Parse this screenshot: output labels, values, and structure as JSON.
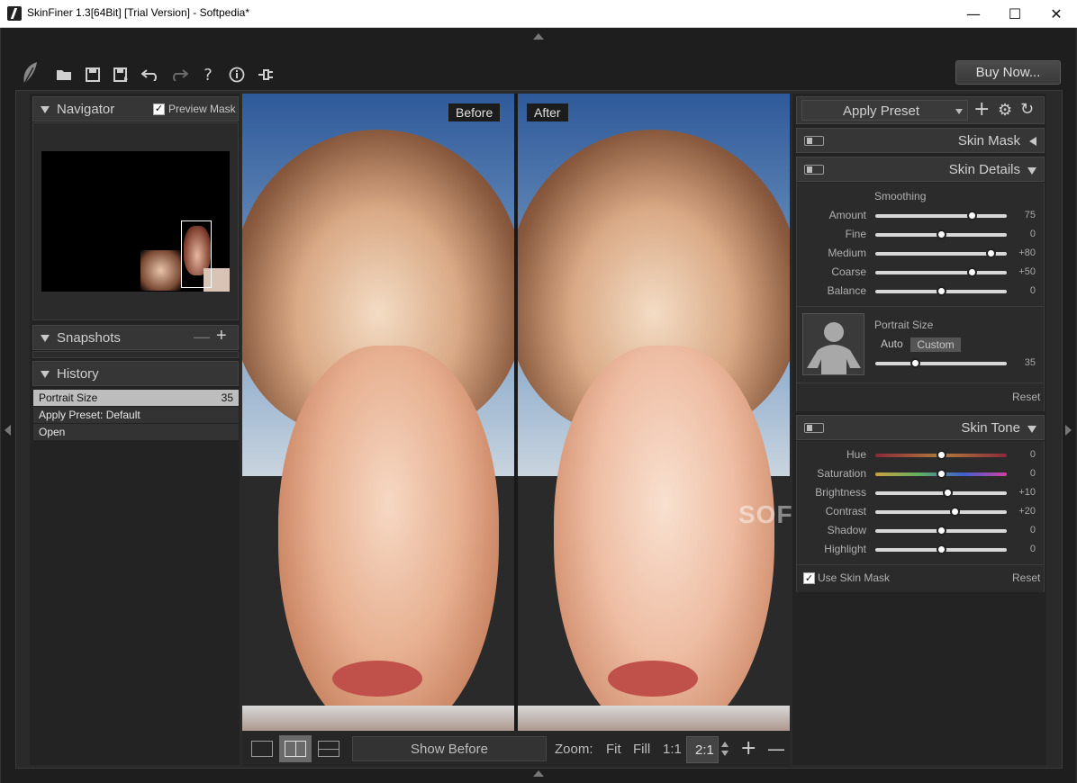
{
  "window": {
    "title": "SkinFiner 1.3[64Bit] [Trial Version] - Softpedia*"
  },
  "toolbar": {
    "buy_label": "Buy Now..."
  },
  "navigator": {
    "title": "Navigator",
    "preview_mask_label": "Preview Mask",
    "preview_mask_checked": true
  },
  "snapshots": {
    "title": "Snapshots"
  },
  "history": {
    "title": "History",
    "items": [
      {
        "label": "Portrait Size",
        "value": "35",
        "selected": true
      },
      {
        "label": "Apply Preset: Default",
        "value": ""
      },
      {
        "label": "Open",
        "value": ""
      }
    ]
  },
  "images": {
    "before_label": "Before",
    "after_label": "After"
  },
  "bottom": {
    "show_before_label": "Show Before",
    "zoom_label": "Zoom:",
    "fit_label": "Fit",
    "fill_label": "Fill",
    "one_to_one_label": "1:1",
    "zoom_value": "2:1"
  },
  "right": {
    "apply_preset_label": "Apply Preset",
    "skin_mask_title": "Skin Mask",
    "skin_details_title": "Skin Details",
    "smoothing_label": "Smoothing",
    "sliders": [
      {
        "label": "Amount",
        "value": "75",
        "pos": 0.73
      },
      {
        "label": "Fine",
        "value": "0",
        "pos": 0.5
      },
      {
        "label": "Medium",
        "value": "+80",
        "pos": 0.88
      },
      {
        "label": "Coarse",
        "value": "+50",
        "pos": 0.73
      },
      {
        "label": "Balance",
        "value": "0",
        "pos": 0.5
      }
    ],
    "portrait": {
      "title": "Portrait Size",
      "auto_label": "Auto",
      "custom_label": "Custom",
      "value": "35",
      "pos": 0.3
    },
    "reset_label": "Reset",
    "skin_tone_title": "Skin Tone",
    "tone_sliders": [
      {
        "label": "Hue",
        "value": "0",
        "pos": 0.5
      },
      {
        "label": "Saturation",
        "value": "0",
        "pos": 0.5
      },
      {
        "label": "Brightness",
        "value": "+10",
        "pos": 0.55
      },
      {
        "label": "Contrast",
        "value": "+20",
        "pos": 0.6
      },
      {
        "label": "Shadow",
        "value": "0",
        "pos": 0.5
      },
      {
        "label": "Highlight",
        "value": "0",
        "pos": 0.5
      }
    ],
    "use_skin_mask_label": "Use Skin Mask",
    "use_skin_mask_checked": true,
    "reset2_label": "Reset"
  },
  "watermark": "SOFTPEDIA"
}
